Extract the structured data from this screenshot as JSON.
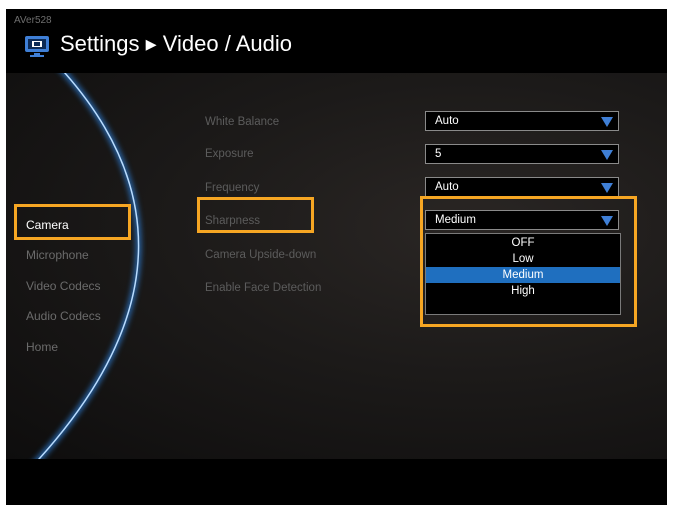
{
  "header": {
    "brand": "AVer528",
    "title": "Settings ▸ Video / Audio"
  },
  "sidebar": {
    "items": [
      {
        "label": "Camera",
        "active": true
      },
      {
        "label": "Microphone"
      },
      {
        "label": "Video Codecs"
      },
      {
        "label": "Audio Codecs"
      },
      {
        "label": "Home"
      }
    ]
  },
  "settings": [
    {
      "label": "White Balance",
      "value": "Auto"
    },
    {
      "label": "Exposure",
      "value": "5"
    },
    {
      "label": "Frequency",
      "value": "Auto"
    },
    {
      "label": "Sharpness",
      "value": "Medium"
    },
    {
      "label": "Camera Upside-down"
    },
    {
      "label": "Enable Face Detection"
    }
  ],
  "sharpness_options": [
    "OFF",
    "Low",
    "Medium",
    "High"
  ],
  "sharpness_selected": "Medium",
  "colors": {
    "highlight": "#f6a623",
    "accent": "#1f6fbf",
    "arrow": "#3f7fd6"
  }
}
